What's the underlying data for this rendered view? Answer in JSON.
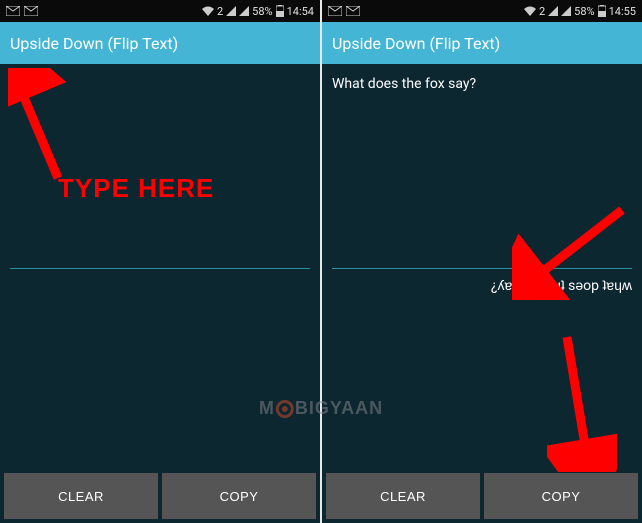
{
  "left": {
    "status": {
      "battery": "58%",
      "time": "14:54",
      "sim": "2"
    },
    "app_title": "Upside Down (Flip Text)",
    "input_text": "",
    "output_text": "",
    "buttons": {
      "clear": "CLEAR",
      "copy": "COPY"
    },
    "annotation": "TYPE HERE"
  },
  "right": {
    "status": {
      "battery": "58%",
      "time": "14:55",
      "sim": "2"
    },
    "app_title": "Upside Down (Flip Text)",
    "input_text": "What does the fox say?",
    "output_text": "¿ʎɐs xoɟ ǝɥʇ sǝop ʇɐɥʍ",
    "buttons": {
      "clear": "CLEAR",
      "copy": "COPY"
    }
  },
  "watermark": {
    "part1": "M",
    "part2": "BIGYAAN"
  }
}
